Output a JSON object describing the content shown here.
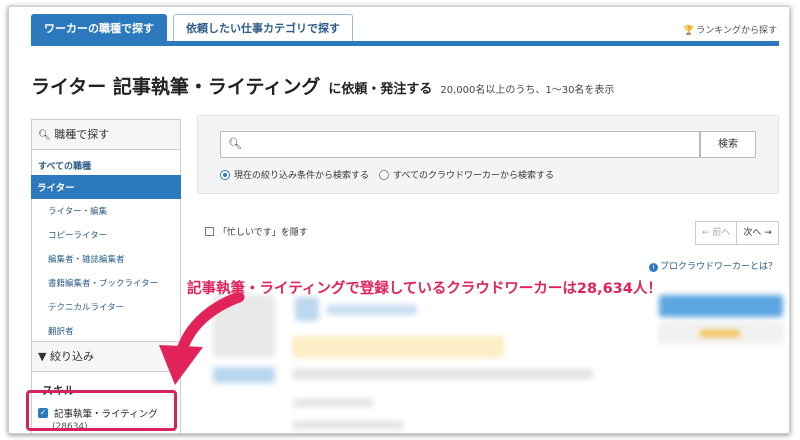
{
  "tabs": [
    {
      "label": "ワーカーの職種で探す",
      "active": true
    },
    {
      "label": "依頼したい仕事カテゴリで探す",
      "active": false
    }
  ],
  "ranking_link": "ランキングから探す",
  "header": {
    "title": "ライター 記事執筆・ライティング",
    "title_suffix": "に依頼・発注する",
    "result_count": "20,000名以上のうち、1〜30名を表示"
  },
  "sidebar": {
    "heading": "職種で探す",
    "all_label": "すべての職種",
    "active_label": "ライター",
    "items": [
      "ライター・編集",
      "コピーライター",
      "編集者・雑誌編集者",
      "書籍編集者・ブックライター",
      "テクニカルライター",
      "翻訳者"
    ]
  },
  "filter": {
    "heading": "絞り込み",
    "skill_label": "スキル",
    "skill_item": "記事執筆・ライティング",
    "skill_count": "(28634)"
  },
  "search": {
    "placeholder": "",
    "button_label": "検索",
    "option_current": "現在の絞り込み条件から検索する",
    "option_all": "すべてのクラウドワーカーから検索する"
  },
  "list": {
    "hide_busy_label": "「忙しいです」を隠す",
    "prev_label": "← 前へ",
    "next_label": "次へ →",
    "pro_link": "プロクラウドワーカーとは？"
  },
  "annotation": "記事執筆・ライティングで登録しているクラウドワーカーは28,634人！",
  "colors": {
    "accent": "#2c79be",
    "highlight": "#e2235a"
  }
}
